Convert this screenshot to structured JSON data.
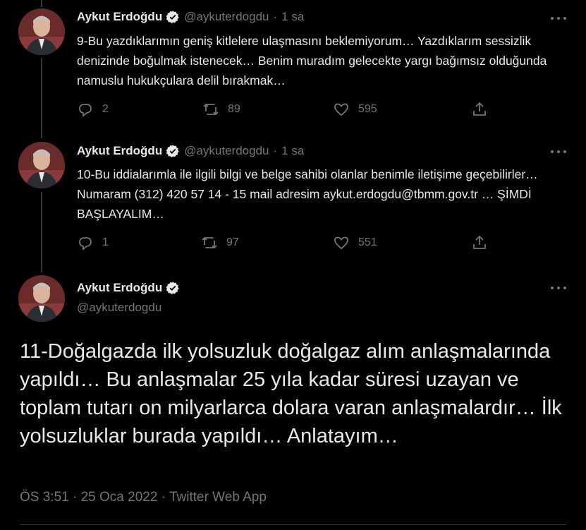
{
  "colors": {
    "background": "#000000",
    "text": "#e7e9ea",
    "muted": "#71767b",
    "verified": "#e7e9ea"
  },
  "tweets": [
    {
      "name": "Aykut Erdoğdu",
      "handle": "@aykuterdogdu",
      "separator": "·",
      "time": "1 sa",
      "text": "9-Bu yazdıklarımın geniş kitlelere ulaşmasını beklemiyorum… Yazdıklarım sessizlik denizinde boğulmak istenecek… Benim muradım gelecekte yargı bağımsız olduğunda namuslu hukukçulara delil bırakmak…",
      "replies": "2",
      "retweets": "89",
      "likes": "595"
    },
    {
      "name": "Aykut Erdoğdu",
      "handle": "@aykuterdogdu",
      "separator": "·",
      "time": "1 sa",
      "text": "10-Bu iddialarımla ile ilgili bilgi ve belge sahibi olanlar benimle iletişime geçebilirler… Numaram (312) 420 57 14 - 15 mail adresim aykut.erdogdu@tbmm.gov.tr … ŞİMDİ BAŞLAYALIM…",
      "replies": "1",
      "retweets": "97",
      "likes": "551"
    }
  ],
  "main_tweet": {
    "name": "Aykut Erdoğdu",
    "handle": "@aykuterdogdu",
    "text": "11-Doğalgazda ilk yolsuzluk doğalgaz alım anlaşmalarında yapıldı… Bu anlaşmalar 25 yıla kadar süresi uzayan ve toplam tutarı on milyarlarca dolara varan anlaşmalardır… İlk yolsuzluklar burada yapıldı… Anlatayım…",
    "meta": "ÖS 3:51 · 25 Oca 2022 · Twitter Web App"
  }
}
